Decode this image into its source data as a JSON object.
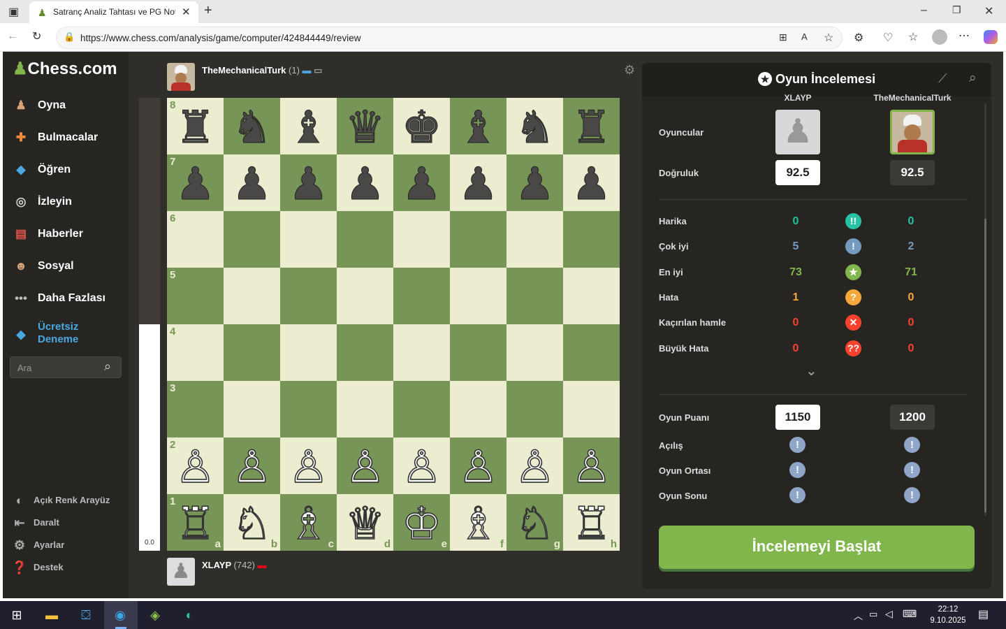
{
  "browser": {
    "tab_title": "Satranç Analiz Tahtası ve PG Nota",
    "url": "https://www.chess.com/analysis/game/computer/424844449/review"
  },
  "sidebar": {
    "logo": "Chess.com",
    "items": [
      {
        "label": "Oyna",
        "icon": "pawn-play-icon"
      },
      {
        "label": "Bulmacalar",
        "icon": "puzzle-icon"
      },
      {
        "label": "Öğren",
        "icon": "learn-cube-icon"
      },
      {
        "label": "İzleyin",
        "icon": "binoculars-icon"
      },
      {
        "label": "Haberler",
        "icon": "news-icon"
      },
      {
        "label": "Sosyal",
        "icon": "social-icon"
      },
      {
        "label": "Daha Fazlası",
        "icon": "more-dots-icon"
      }
    ],
    "trial": "Ücretsiz Deneme",
    "trial_line1": "Ücretsiz",
    "trial_line2": "Deneme",
    "search_placeholder": "Ara",
    "footer": [
      {
        "label": "Açık Renk Arayüz"
      },
      {
        "label": "Daralt"
      },
      {
        "label": "Ayarlar"
      },
      {
        "label": "Destek"
      }
    ]
  },
  "top_player": {
    "name": "TheMechanicalTurk",
    "rating": "(1)"
  },
  "bottom_player": {
    "name": "XLAYP",
    "rating": "(742)"
  },
  "eval_bar": {
    "value": "0.0"
  },
  "board": {
    "files": [
      "a",
      "b",
      "c",
      "d",
      "e",
      "f",
      "g",
      "h"
    ],
    "ranks": [
      "8",
      "7",
      "6",
      "5",
      "4",
      "3",
      "2",
      "1"
    ],
    "rank8": [
      "♜",
      "♞",
      "♝",
      "♛",
      "♚",
      "♝",
      "♞",
      "♜"
    ],
    "rank7": [
      "♟",
      "♟",
      "♟",
      "♟",
      "♟",
      "♟",
      "♟",
      "♟"
    ],
    "rank2": [
      "♙",
      "♙",
      "♙",
      "♙",
      "♙",
      "♙",
      "♙",
      "♙"
    ],
    "rank1": [
      "♖",
      "♘",
      "♗",
      "♕",
      "♔",
      "♗",
      "♘",
      "♖"
    ]
  },
  "review": {
    "title": "Oyun İncelemesi",
    "white_name": "XLAYP",
    "black_name": "TheMechanicalTurk",
    "players_label": "Oyuncular",
    "accuracy_label": "Doğruluk",
    "accuracy_white": "92.5",
    "accuracy_black": "92.5",
    "rows": [
      {
        "label": "Harika",
        "white": "0",
        "black": "0",
        "symbol": "!!",
        "color": "#26c2a3"
      },
      {
        "label": "Çok iyi",
        "white": "5",
        "black": "2",
        "symbol": "!",
        "color": "#749bbf"
      },
      {
        "label": "En iyi",
        "white": "73",
        "black": "71",
        "symbol": "★",
        "color": "#81b64c"
      },
      {
        "label": "Hata",
        "white": "1",
        "black": "0",
        "symbol": "?",
        "color": "#f7a83b"
      },
      {
        "label": "Kaçırılan hamle",
        "white": "0",
        "black": "0",
        "symbol": "✕",
        "color": "#fa412d"
      },
      {
        "label": "Büyük Hata",
        "white": "0",
        "black": "0",
        "symbol": "??",
        "color": "#fa412d"
      }
    ],
    "game_rating_label": "Oyun Puanı",
    "game_rating_white": "1150",
    "game_rating_black": "1200",
    "phases": [
      "Açılış",
      "Oyun Ortası",
      "Oyun Sonu"
    ],
    "start_button": "İncelemeyi Başlat"
  },
  "taskbar": {
    "time": "22:12",
    "date": "9.10.2025"
  }
}
